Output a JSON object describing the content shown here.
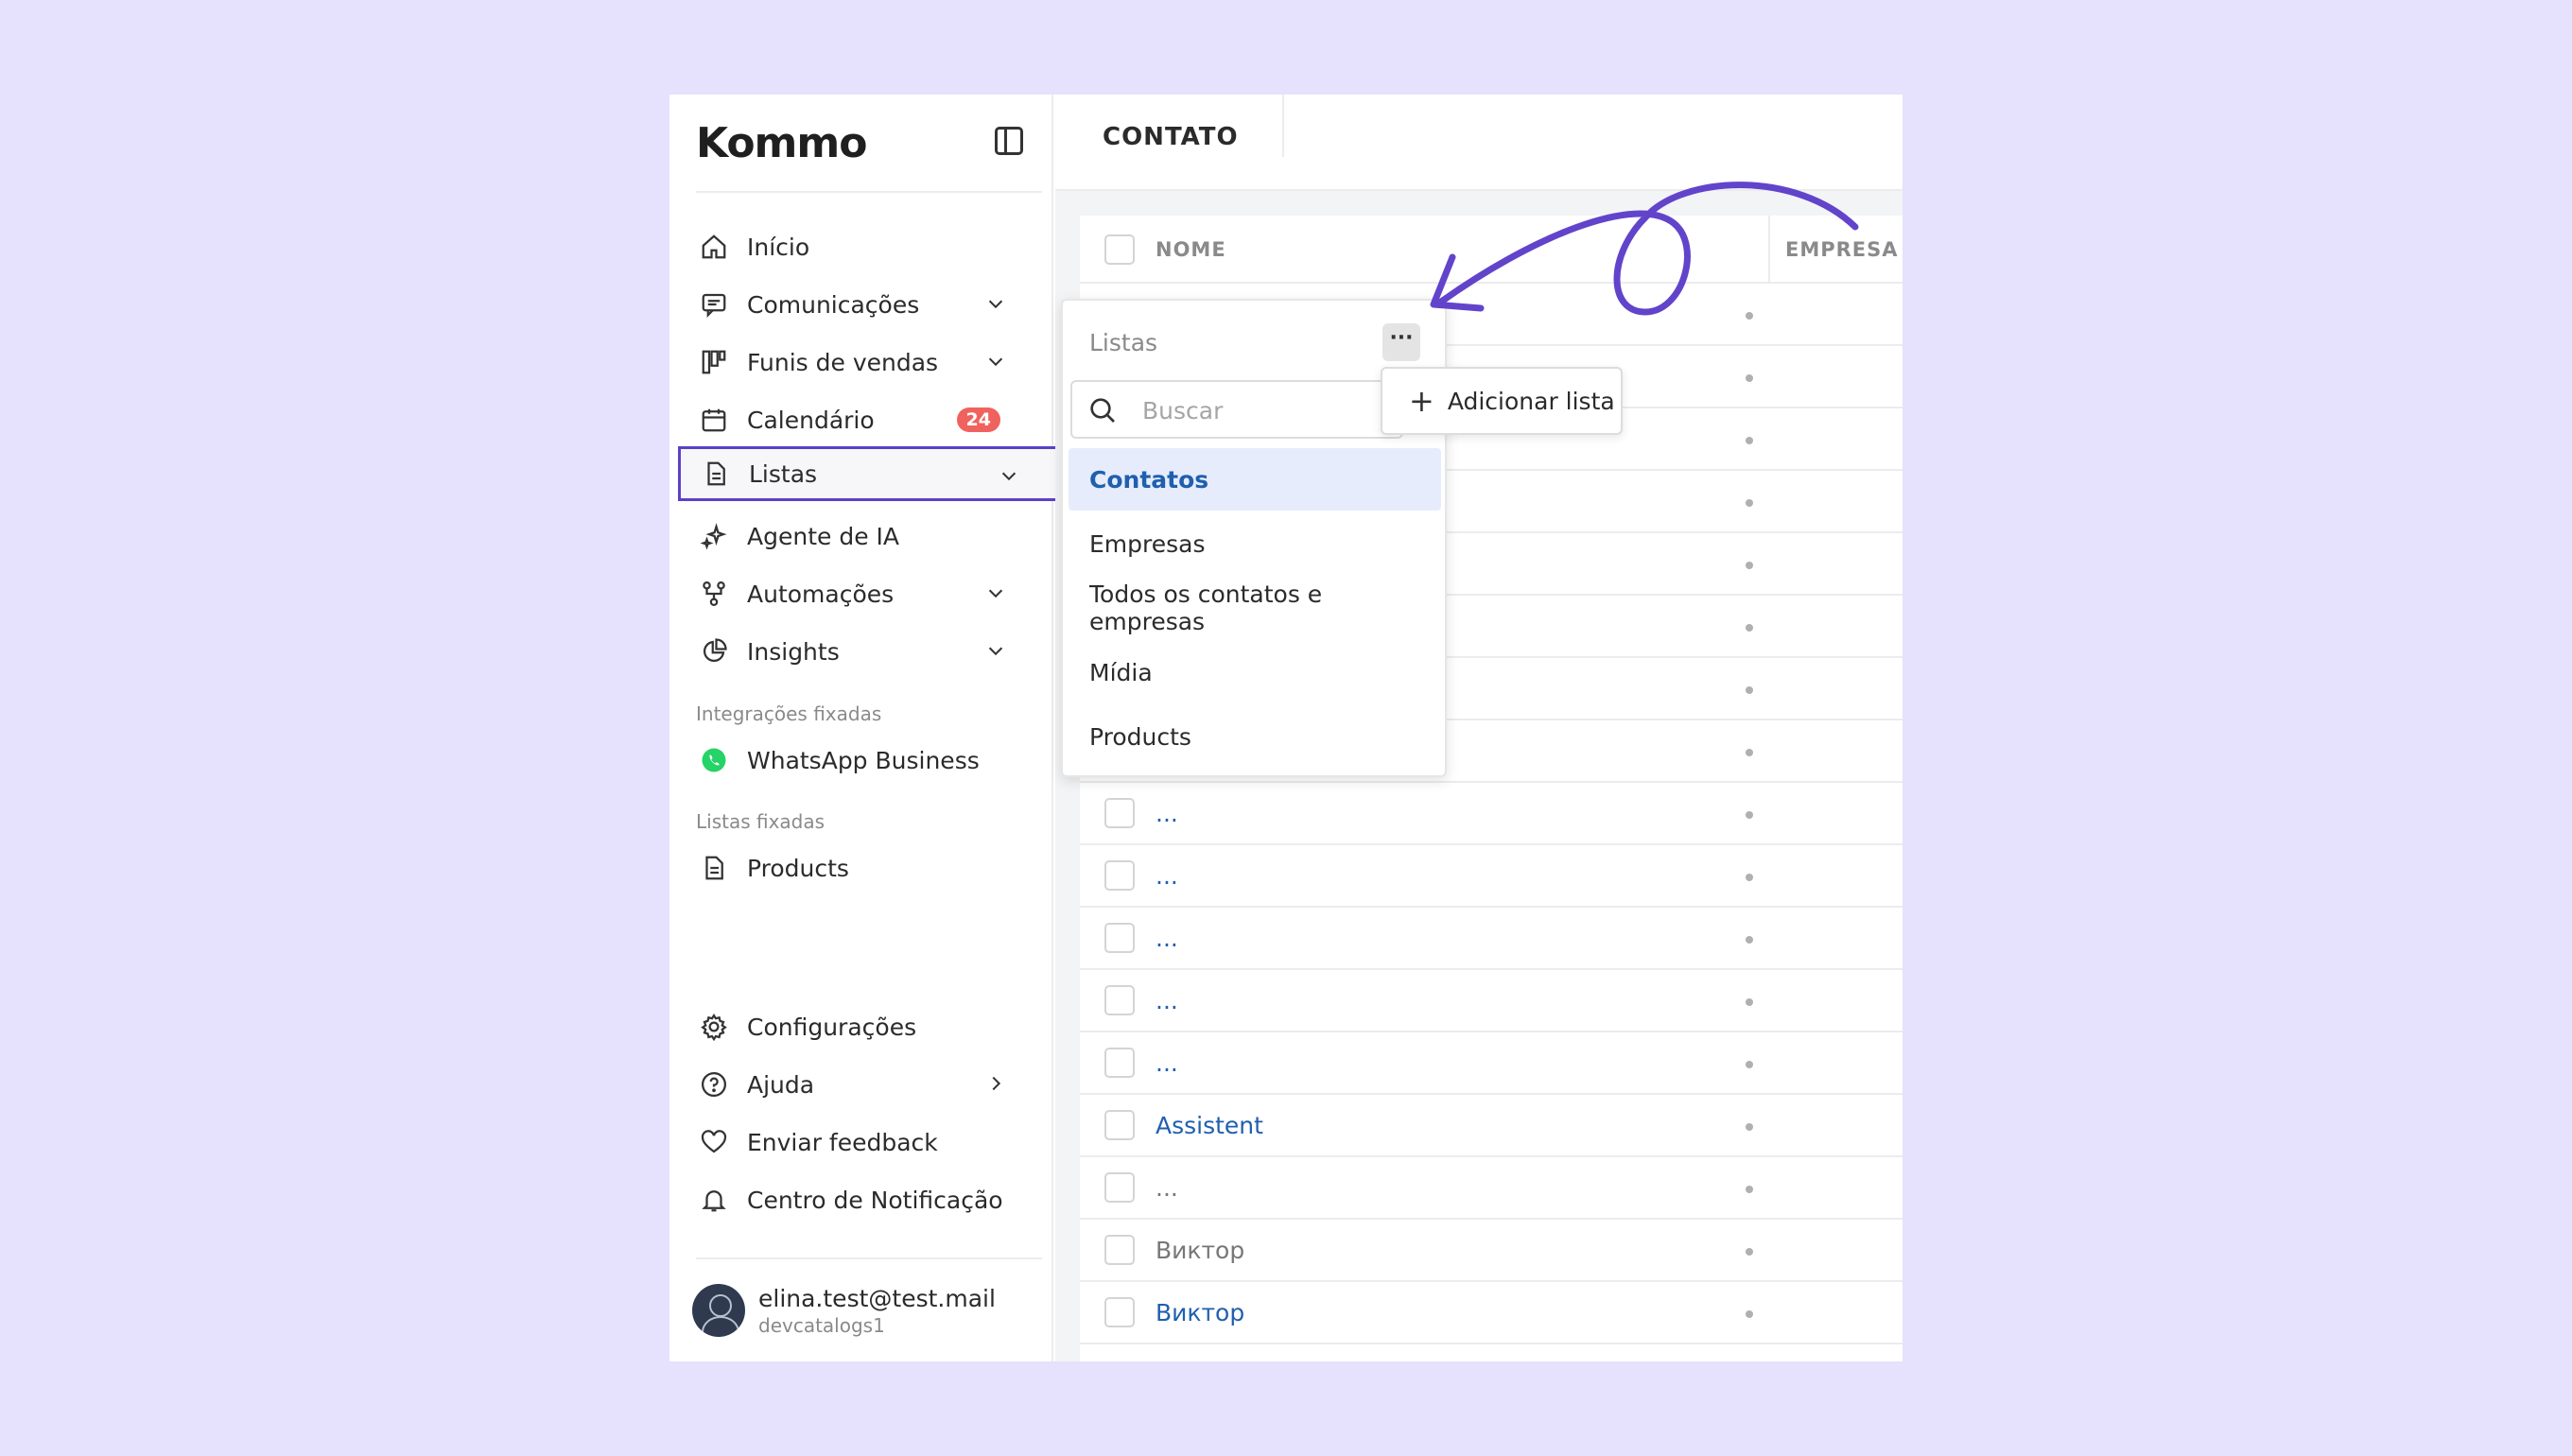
{
  "sidebar": {
    "logo": "Kommo",
    "items": [
      {
        "label": "Início"
      },
      {
        "label": "Comunicações"
      },
      {
        "label": "Funis de vendas"
      },
      {
        "label": "Calendário",
        "badge": "24"
      },
      {
        "label": "Listas"
      },
      {
        "label": "Agente de IA"
      },
      {
        "label": "Automações"
      },
      {
        "label": "Insights"
      }
    ],
    "pinned_integrations_label": "Integrações fixadas",
    "pinned_integrations": [
      {
        "label": "WhatsApp Business"
      }
    ],
    "pinned_lists_label": "Listas fixadas",
    "pinned_lists": [
      {
        "label": "Products"
      }
    ],
    "bottom_items": [
      {
        "label": "Configurações"
      },
      {
        "label": "Ajuda"
      },
      {
        "label": "Enviar feedback"
      },
      {
        "label": "Centro de Notificação"
      }
    ],
    "user": {
      "email": "elina.test@test.mail",
      "org": "devcatalogs1"
    }
  },
  "main": {
    "title": "CONTATO",
    "columns": {
      "name": "NOME",
      "company": "EMPRESA"
    },
    "rows": [
      {
        "name": "..."
      },
      {
        "name": "..."
      },
      {
        "name": "..."
      },
      {
        "name": "..."
      },
      {
        "name": "..."
      },
      {
        "name": "Assistent"
      },
      {
        "name": "..."
      },
      {
        "name": "Виктор"
      },
      {
        "name": "Виктор"
      }
    ]
  },
  "lists_panel": {
    "title": "Listas",
    "more_label": "···",
    "search_placeholder": "Buscar",
    "options": [
      {
        "label": "Contatos",
        "selected": true
      },
      {
        "label": "Empresas"
      },
      {
        "label": "Todos os contatos e empresas"
      },
      {
        "label": "Mídia"
      },
      {
        "label": "Products"
      }
    ]
  },
  "add_list": {
    "label": "Adicionar lista",
    "plus": "+"
  },
  "colors": {
    "accent": "#5c40c8",
    "link": "#1f5fae",
    "badge": "#f0625d",
    "background": "#e6e1fd",
    "whatsapp": "#25d366"
  }
}
